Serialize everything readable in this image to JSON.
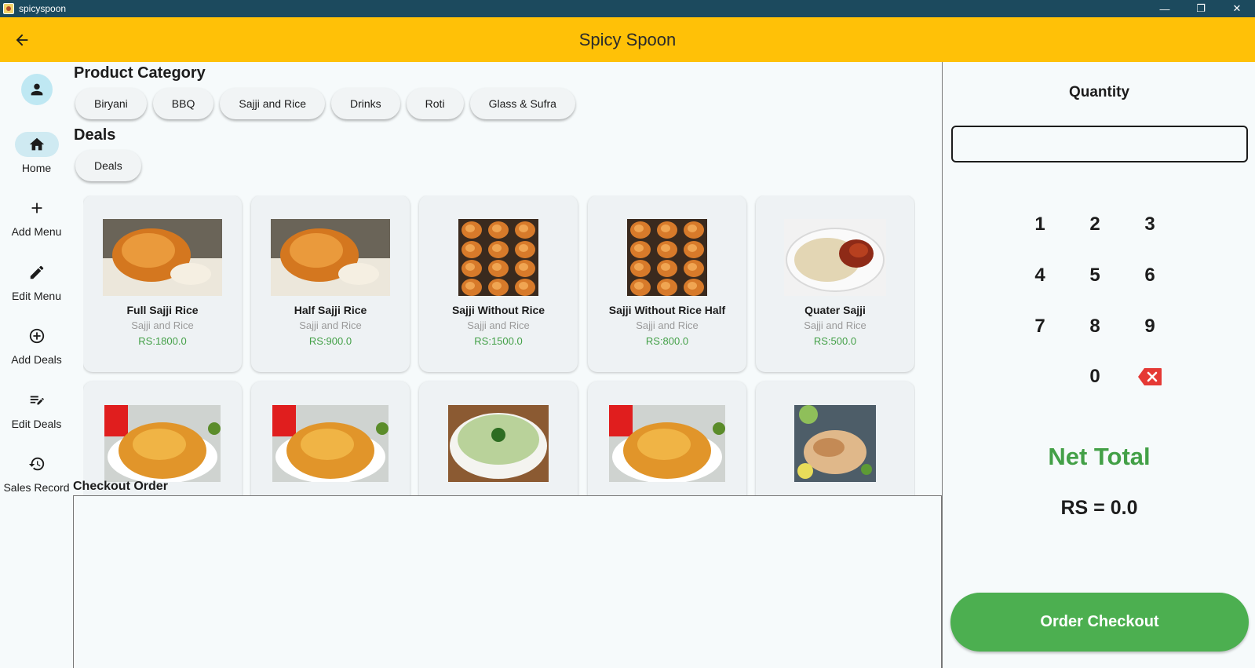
{
  "window": {
    "title": "spicyspoon",
    "minimize_glyph": "—",
    "restore_glyph": "❐",
    "close_glyph": "✕"
  },
  "appbar": {
    "title": "Spicy Spoon",
    "back_icon": "arrow-left-icon"
  },
  "nav": {
    "items": [
      {
        "label": "Home",
        "icon": "home-icon"
      },
      {
        "label": "Add Menu",
        "icon": "plus-icon"
      },
      {
        "label": "Edit Menu",
        "icon": "pencil-icon"
      },
      {
        "label": "Add Deals",
        "icon": "add-circle-icon"
      },
      {
        "label": "Edit Deals",
        "icon": "edit-list-icon"
      },
      {
        "label": "Sales Record",
        "icon": "history-icon"
      }
    ]
  },
  "categories": {
    "title": "Product Category",
    "items": [
      "Biryani",
      "BBQ",
      "Sajji and Rice",
      "Drinks",
      "Roti",
      "Glass & Sufra"
    ]
  },
  "deals": {
    "title": "Deals",
    "items": [
      "Deals"
    ]
  },
  "products": [
    {
      "name": "Full Sajji Rice",
      "category": "Sajji and Rice",
      "price": "RS:1800.0",
      "image": "roast-chicken-rice"
    },
    {
      "name": "Half Sajji Rice",
      "category": "Sajji and Rice",
      "price": "RS:900.0",
      "image": "roast-chicken-rice"
    },
    {
      "name": "Sajji Without Rice",
      "category": "Sajji and Rice",
      "price": "RS:1500.0",
      "image": "chickens-on-skewers"
    },
    {
      "name": "Sajji Without Rice Half",
      "category": "Sajji and Rice",
      "price": "RS:800.0",
      "image": "chickens-on-skewers"
    },
    {
      "name": "Quater Sajji",
      "category": "Sajji and Rice",
      "price": "RS:500.0",
      "image": "rice-plate-chicken-leg"
    },
    {
      "name": "",
      "category": "",
      "price": "",
      "image": "biryani-plate"
    },
    {
      "name": "",
      "category": "",
      "price": "",
      "image": "biryani-plate"
    },
    {
      "name": "",
      "category": "",
      "price": "",
      "image": "green-raita-bowl"
    },
    {
      "name": "",
      "category": "",
      "price": "",
      "image": "biryani-plate"
    },
    {
      "name": "",
      "category": "",
      "price": "",
      "image": "grilled-chicken-board"
    }
  ],
  "checkout": {
    "label": "Checkout Order"
  },
  "quantity": {
    "label": "Quantity",
    "value": "",
    "keys": [
      "1",
      "2",
      "3",
      "4",
      "5",
      "6",
      "7",
      "8",
      "9",
      "0"
    ],
    "backspace_icon": "backspace-icon"
  },
  "net_total": {
    "label": "Net Total",
    "value": "RS = 0.0"
  },
  "order_button": {
    "label": "Order Checkout"
  },
  "colors": {
    "appbar": "#ffc107",
    "titlebar": "#1c4a5e",
    "accent_green": "#4caf50",
    "price_green": "#43a047",
    "backspace_red": "#e53935"
  }
}
